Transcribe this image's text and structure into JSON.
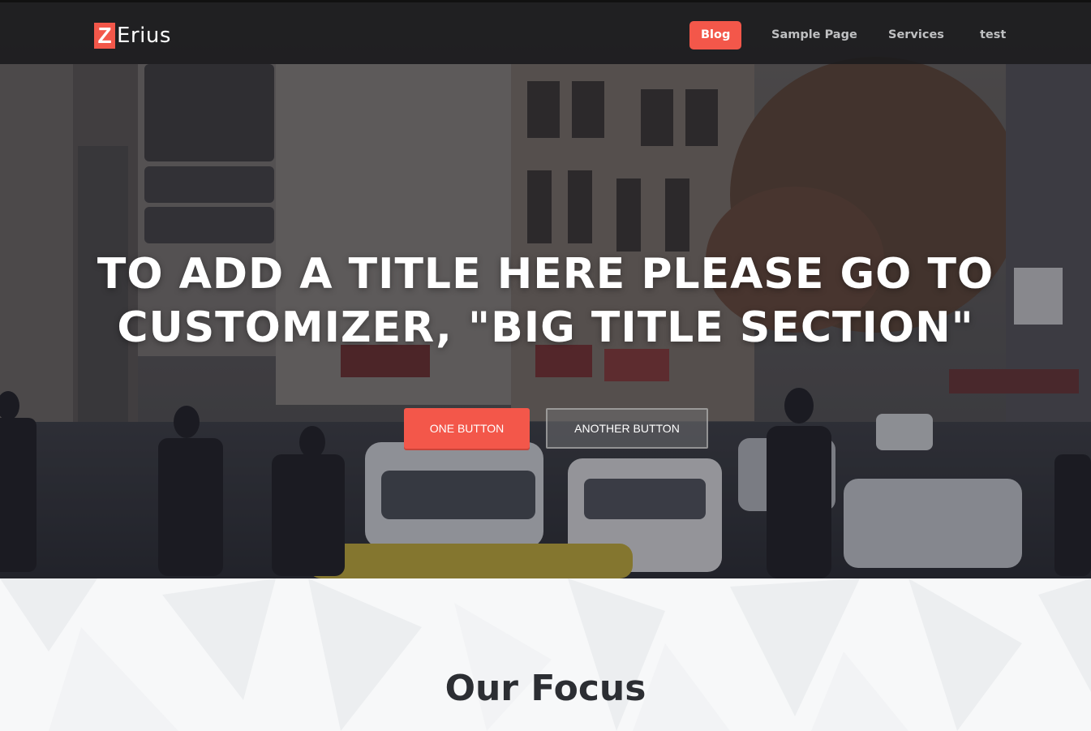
{
  "brand": {
    "logo_letter": "Z",
    "logo_text": "Erius"
  },
  "nav": {
    "items": [
      {
        "label": "Blog",
        "active": true
      },
      {
        "label": "Sample Page",
        "active": false
      },
      {
        "label": "Services",
        "active": false
      },
      {
        "label": "test",
        "active": false
      }
    ]
  },
  "hero": {
    "title_line1": "TO ADD A TITLE HERE PLEASE GO TO",
    "title_line2": "CUSTOMIZER, \"BIG TITLE SECTION\"",
    "primary_button": "ONE BUTTON",
    "secondary_button": "ANOTHER BUTTON"
  },
  "focus": {
    "title": "Our Focus"
  },
  "colors": {
    "accent": "#f3574a",
    "nav_bg": "#1a1a1c",
    "nav_text": "#bfc0c2",
    "heading_dark": "#2c2e33",
    "section_bg": "#f7f8f9"
  }
}
